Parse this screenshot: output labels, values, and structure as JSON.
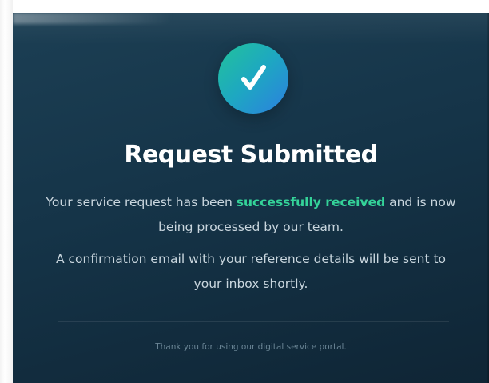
{
  "card": {
    "icon": "check-icon",
    "title": "Request Submitted",
    "message1": {
      "before": "Your service request has been ",
      "highlight": "successfully received",
      "after": " and is now being processed by our team."
    },
    "message2": "A confirmation email with your reference details will be sent to your inbox shortly.",
    "footer": "Thank you for using our digital service portal."
  },
  "colors": {
    "card_background": "#153448",
    "accent_green": "#34d399",
    "icon_gradient_start": "#21c39a",
    "icon_gradient_end": "#2c7fe0",
    "title": "#ffffff",
    "body_text": "#c9d6de",
    "footer_text": "#6a8595"
  }
}
